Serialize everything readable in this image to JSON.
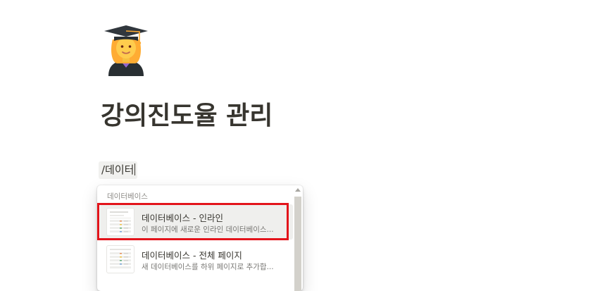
{
  "page": {
    "icon": "woman-graduate-emoji",
    "title": "강의진도율 관리"
  },
  "editor": {
    "command_text": "/데이터"
  },
  "slash_menu": {
    "section_label": "데이터베이스",
    "items": [
      {
        "title": "데이터베이스 - 인라인",
        "description": "이 페이지에 새로운 인라인 데이터베이스...",
        "selected": true
      },
      {
        "title": "데이터베이스 - 전체 페이지",
        "description": "새 데이터베이스를 하위 페이지로 추가합...",
        "selected": false
      }
    ]
  },
  "annotation": {
    "highlight_color": "#e3141b"
  }
}
